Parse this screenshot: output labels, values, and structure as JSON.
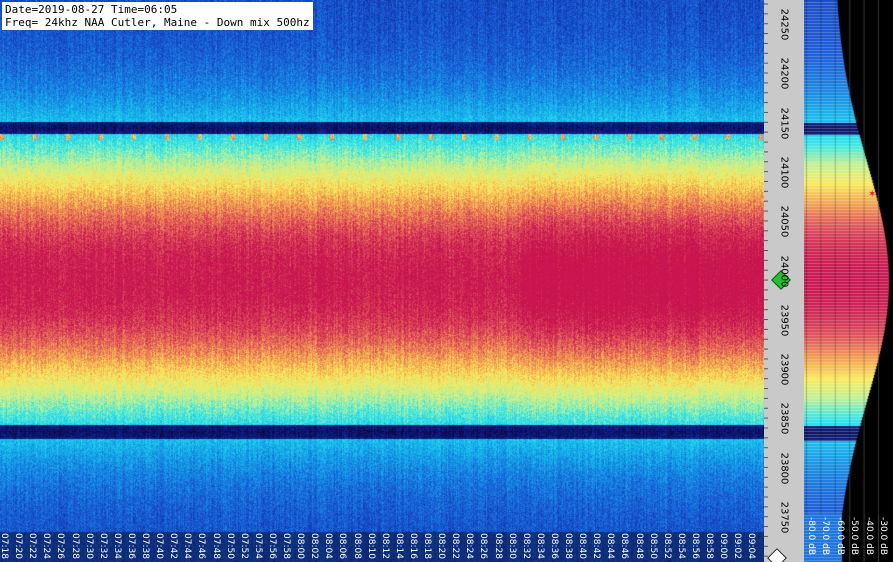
{
  "info": {
    "date_line": "Date=2019-08-27 Time=06:05",
    "freq_line": "Freq= 24khz NAA Cutler, Maine - Down mix 500hz"
  },
  "frequency_axis": {
    "labels": [
      "24250",
      "24200",
      "24150",
      "24100",
      "24050",
      "24000",
      "23950",
      "23900",
      "23850",
      "23800",
      "23750"
    ]
  },
  "db_scale": {
    "labels": [
      "-80.0 dB",
      "-70.0 dB",
      "-60.0 dB",
      "-50.0 dB",
      "-40.0 dB",
      "-30.0 dB"
    ]
  },
  "time_axis": {
    "labels": [
      "07:18",
      "07:20",
      "07:22",
      "07:24",
      "07:26",
      "07:28",
      "07:30",
      "07:32",
      "07:34",
      "07:36",
      "07:38",
      "07:40",
      "07:42",
      "07:44",
      "07:46",
      "07:48",
      "07:50",
      "07:52",
      "07:54",
      "07:56",
      "07:58",
      "08:00",
      "08:02",
      "08:04",
      "08:06",
      "08:08",
      "08:10",
      "08:12",
      "08:14",
      "08:16",
      "08:18",
      "08:20",
      "08:22",
      "08:24",
      "08:26",
      "08:28",
      "08:30",
      "08:32",
      "08:34",
      "08:36",
      "08:38",
      "08:40",
      "08:42",
      "08:44",
      "08:46",
      "08:48",
      "08:50",
      "08:52",
      "08:54",
      "08:56",
      "08:58",
      "09:00",
      "09:02",
      "09:04"
    ]
  },
  "colors": {
    "frame_background": "#000000",
    "axis_background": "#c9c9c9",
    "marker": "#22c22c",
    "peak_marker": "#e0201a"
  },
  "icons": {
    "center_marker": "green-diamond",
    "scroll_handle": "white-diamond"
  }
}
